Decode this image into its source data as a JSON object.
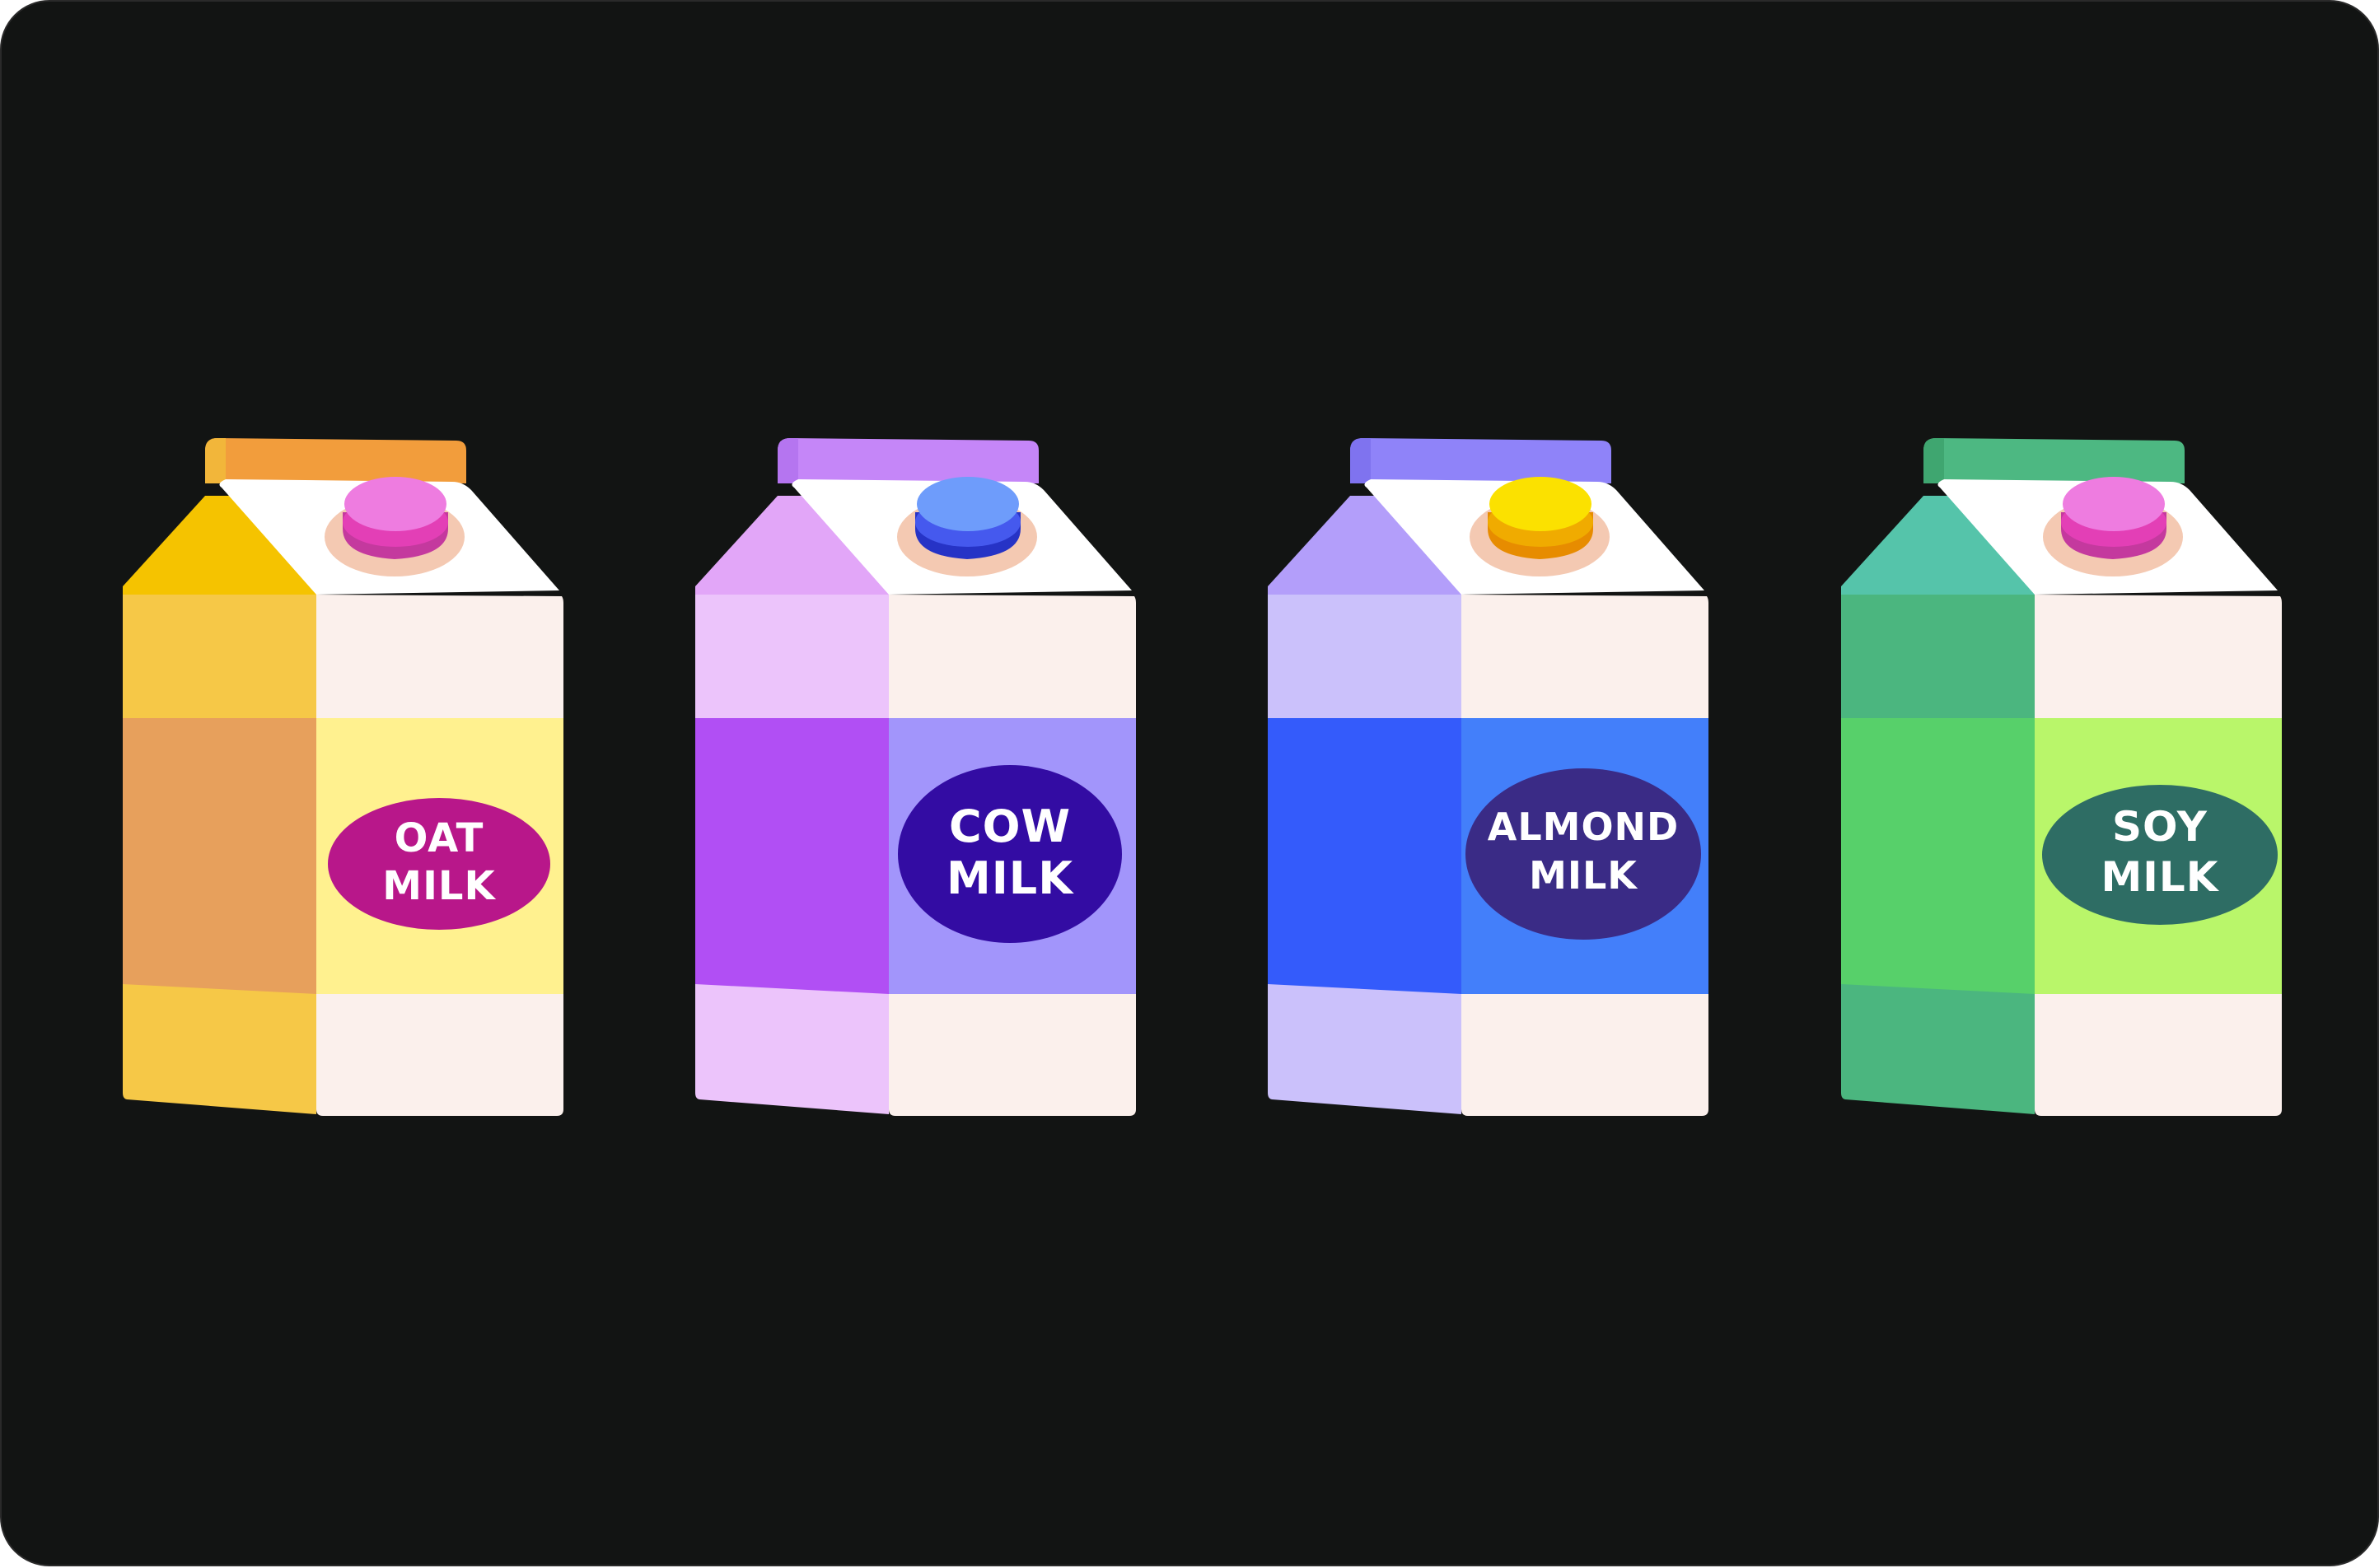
{
  "cartons": [
    {
      "line1": "OAT",
      "line2": "MILK",
      "colors": {
        "tab": "#f29d3c",
        "tab_edge": "#f2b63a",
        "side_top": "#f5c300",
        "side": "#f6c847",
        "side_band": "#e7a05c",
        "front_band": "#fff18f",
        "front": "#fbf0ec",
        "cap_top": "#ee7ce0",
        "cap_side": "#c4399e",
        "cap_rim": "#e33fb6",
        "cap_ring": "#f4c9b2",
        "label": "#b8178a"
      }
    },
    {
      "line1": "COW",
      "line2": "MILK",
      "colors": {
        "tab": "#c586f8",
        "tab_edge": "#b575f0",
        "side_top": "#e2a6f8",
        "side": "#ecc4fb",
        "side_band": "#b14ff4",
        "front_band": "#a295fb",
        "front": "#fbf0ec",
        "cap_top": "#6e9cfb",
        "cap_side": "#2633c6",
        "cap_rim": "#4559ee",
        "cap_ring": "#f4c9b2",
        "label": "#330ca3"
      }
    },
    {
      "line1": "ALMOND",
      "line2": "MILK",
      "colors": {
        "tab": "#8f83f9",
        "tab_edge": "#7f73ef",
        "side_top": "#b39efa",
        "side": "#cbc1fb",
        "side_band": "#345bfb",
        "front_band": "#437ffa",
        "front": "#fbf0ec",
        "cap_top": "#fbe100",
        "cap_side": "#e78c00",
        "cap_rim": "#f0ab00",
        "cap_ring": "#f4c9b2",
        "label": "#3a2b86"
      }
    },
    {
      "line1": "SOY",
      "line2": "MILK",
      "colors": {
        "tab": "#4db882",
        "tab_edge": "#3fa670",
        "side_top": "#55c4aa",
        "side": "#4bb67f",
        "side_band": "#57d06a",
        "front_band": "#b9f66a",
        "front": "#fbf0ec",
        "cap_top": "#ee7ce0",
        "cap_side": "#c4399e",
        "cap_rim": "#e33fb6",
        "cap_ring": "#f4c9b2",
        "label": "#2e6d64"
      }
    }
  ]
}
